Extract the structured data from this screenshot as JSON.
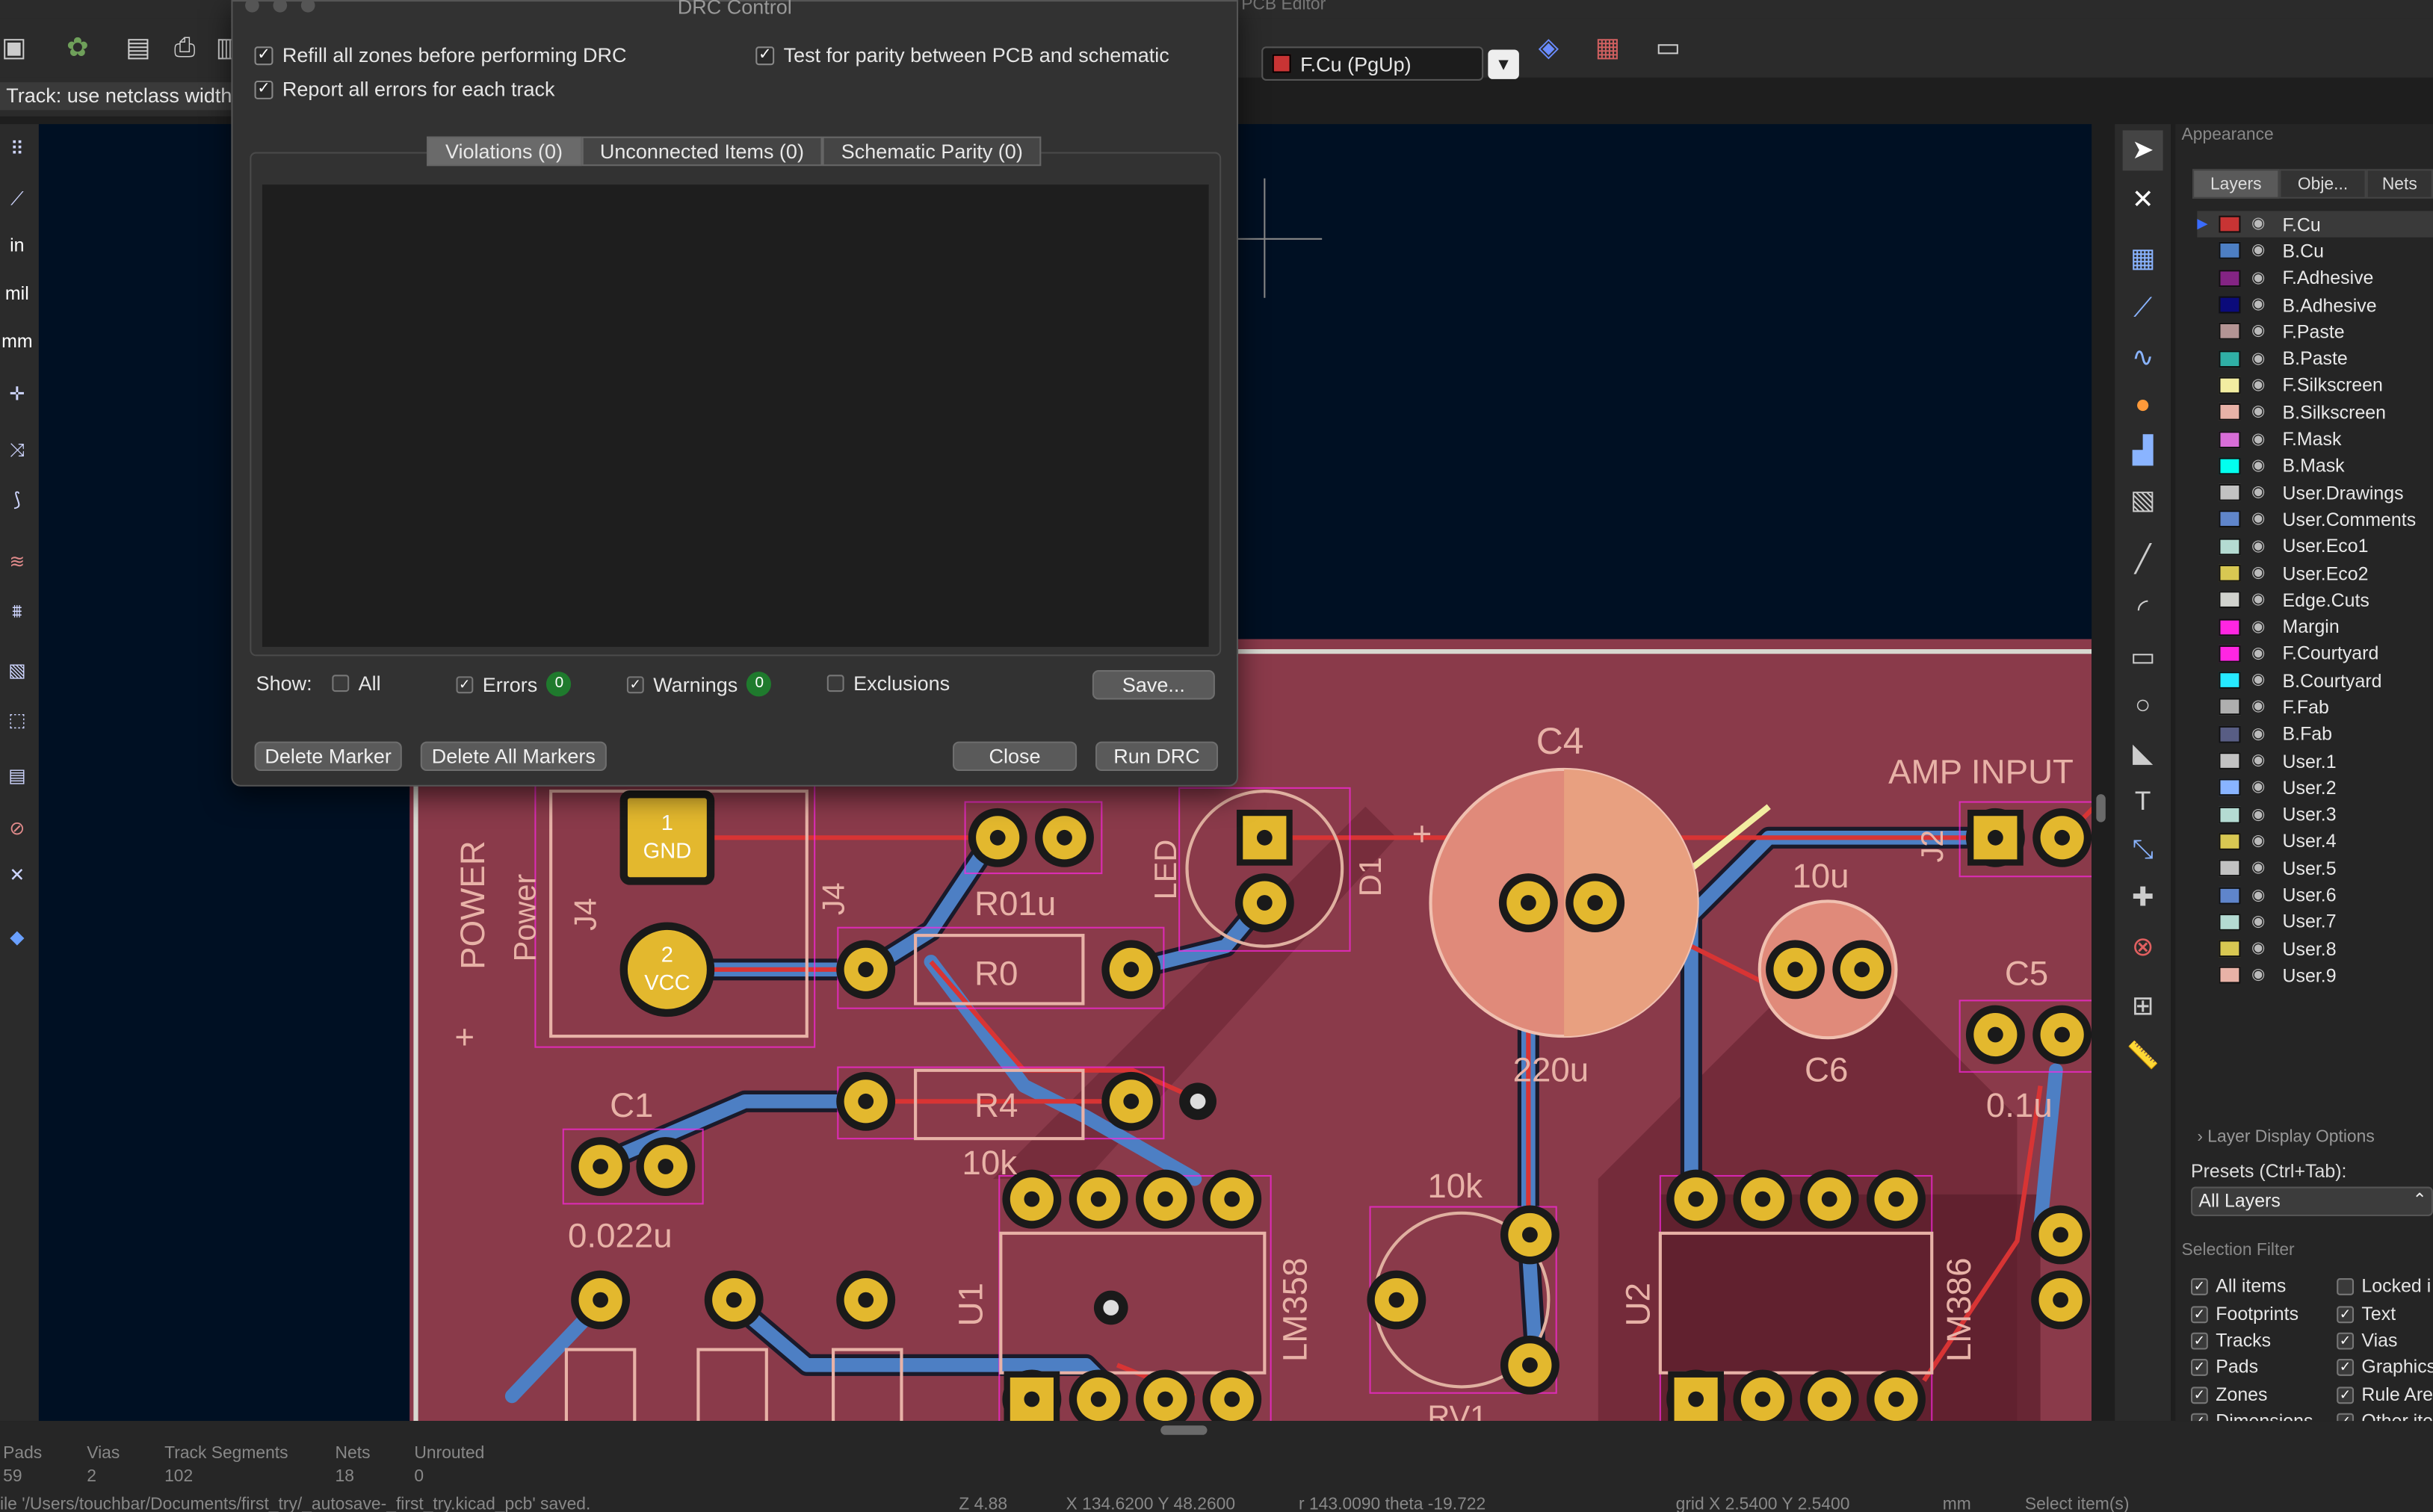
{
  "window": {
    "app_title": "PCB Editor",
    "dialog_title": "DRC Control"
  },
  "toolbar": {
    "active_layer": "F.Cu (PgUp)",
    "active_layer_color": "#c83434",
    "track_width": "Track: use netclass width",
    "icons": [
      "save-icon",
      "3d-viewer-icon",
      "page-setup-icon",
      "print-icon",
      "layer-pair-icon",
      "flip-board-icon",
      "scripting-console-icon"
    ]
  },
  "left_toolbar": {
    "units_in": "in",
    "units_mil": "mil",
    "units_mm": "mm"
  },
  "drc": {
    "opt_refill": "Refill all zones before performing DRC",
    "opt_parity": "Test for parity between PCB and schematic",
    "opt_report": "Report all errors for each track",
    "tab_violations": "Violations (0)",
    "tab_unconnected": "Unconnected Items (0)",
    "tab_parity": "Schematic Parity (0)",
    "show_label": "Show:",
    "show_all": "All",
    "show_errors": "Errors",
    "errors_count": "0",
    "show_warnings": "Warnings",
    "warnings_count": "0",
    "show_exclusions": "Exclusions",
    "save_btn": "Save...",
    "delete_marker_btn": "Delete Marker",
    "delete_all_btn": "Delete All Markers",
    "close_btn": "Close",
    "run_btn": "Run DRC"
  },
  "appearance": {
    "title": "Appearance",
    "tab_layers": "Layers",
    "tab_objects": "Obje...",
    "tab_nets": "Nets",
    "layers": [
      {
        "name": "F.Cu",
        "color": "#c83434"
      },
      {
        "name": "B.Cu",
        "color": "#4d7fc4"
      },
      {
        "name": "F.Adhesive",
        "color": "#842484"
      },
      {
        "name": "B.Adhesive",
        "color": "#0b0b7a"
      },
      {
        "name": "F.Paste",
        "color": "#b49494"
      },
      {
        "name": "B.Paste",
        "color": "#2fb0a6"
      },
      {
        "name": "F.Silkscreen",
        "color": "#f2eda1"
      },
      {
        "name": "B.Silkscreen",
        "color": "#e8b2a7"
      },
      {
        "name": "F.Mask",
        "color": "#d86dd8"
      },
      {
        "name": "B.Mask",
        "color": "#02ffee"
      },
      {
        "name": "User.Drawings",
        "color": "#c2c2c2"
      },
      {
        "name": "User.Comments",
        "color": "#5f85cb"
      },
      {
        "name": "User.Eco1",
        "color": "#b4dbd2"
      },
      {
        "name": "User.Eco2",
        "color": "#d8c852"
      },
      {
        "name": "Edge.Cuts",
        "color": "#d0d2cd"
      },
      {
        "name": "Margin",
        "color": "#ff26e2"
      },
      {
        "name": "F.Courtyard",
        "color": "#ff26e2"
      },
      {
        "name": "B.Courtyard",
        "color": "#26e9ff"
      },
      {
        "name": "F.Fab",
        "color": "#afafaf"
      },
      {
        "name": "B.Fab",
        "color": "#585d84"
      },
      {
        "name": "User.1",
        "color": "#c2c2c2"
      },
      {
        "name": "User.2",
        "color": "#89b4ff"
      },
      {
        "name": "User.3",
        "color": "#b4dbd2"
      },
      {
        "name": "User.4",
        "color": "#d8c852"
      },
      {
        "name": "User.5",
        "color": "#c2c2c2"
      },
      {
        "name": "User.6",
        "color": "#5f85cb"
      },
      {
        "name": "User.7",
        "color": "#b4dbd2"
      },
      {
        "name": "User.8",
        "color": "#d8c852"
      },
      {
        "name": "User.9",
        "color": "#e8b2a7"
      }
    ],
    "layer_display_options": "Layer Display Options",
    "presets_label": "Presets (Ctrl+Tab):",
    "presets_value": "All Layers",
    "selection_filter": "Selection Filter",
    "filters": [
      "All items",
      "Locked i",
      "Footprints",
      "Text",
      "Tracks",
      "Vias",
      "Pads",
      "Graphics",
      "Zones",
      "Rule Are",
      "Dimensions",
      "Other ite"
    ]
  },
  "status": {
    "pads_lbl": "Pads",
    "pads_val": "59",
    "vias_lbl": "Vias",
    "vias_val": "2",
    "segs_lbl": "Track Segments",
    "segs_val": "102",
    "nets_lbl": "Nets",
    "nets_val": "18",
    "unrouted_lbl": "Unrouted",
    "unrouted_val": "0",
    "message": "ile '/Users/touchbar/Documents/first_try/_autosave-_first_try.kicad_pcb' saved.",
    "zoom": "Z 4.88",
    "coords": "X 134.6200  Y 48.2600",
    "polar": "r 143.0090  theta -19.722",
    "grid": "grid X 2.5400  Y 2.5400",
    "units": "mm",
    "action": "Select item(s)"
  },
  "pcb": {
    "labels": {
      "C4": "C4",
      "amp_input": "AMP INPUT",
      "c5": "C5",
      "c6": "C6",
      "c1": "C1",
      "r0": "R0",
      "r4": "R4",
      "d1": "D1",
      "led": "LED",
      "power": "POWER",
      "power_small": "Power",
      "j4": "J4",
      "j4b": "J4",
      "j2": "J2",
      "u1": "U1",
      "u2": "U2",
      "lm358": "LM358",
      "lm386": "LM386",
      "rv1": "RV1",
      "v10u": "10u",
      "v220u": "220u",
      "v01u": "0.1u",
      "v0022u": "0.022u",
      "v10k": "10k",
      "v10k2": "10k",
      "gnd": "GND",
      "vcc": "VCC",
      "one": "1",
      "two": "2",
      "r01u": "R01u"
    }
  }
}
